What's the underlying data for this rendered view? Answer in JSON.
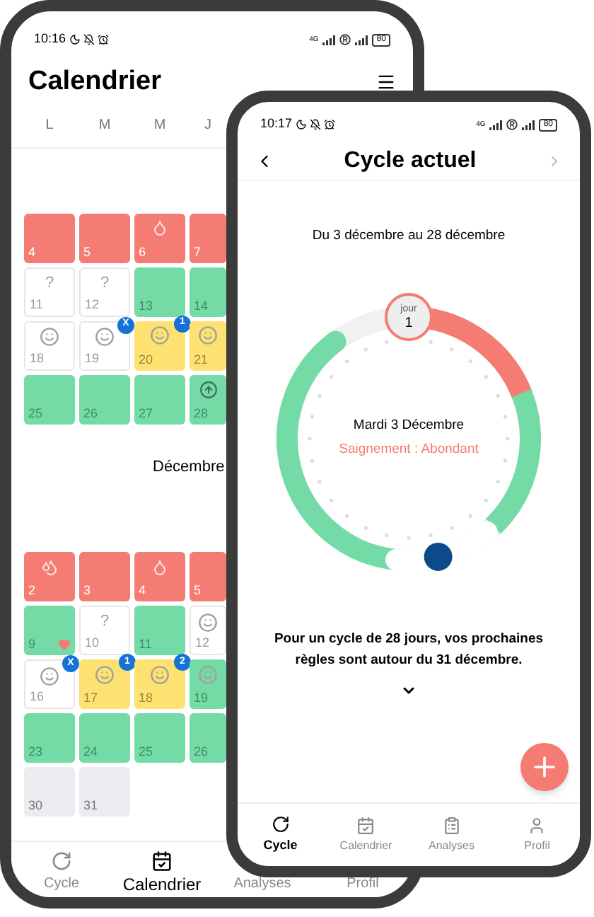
{
  "back_phone": {
    "status_bar": {
      "time": "10:16",
      "network": "4G",
      "battery": "80"
    },
    "title": "Calendrier",
    "weekdays": [
      "L",
      "M",
      "M",
      "J"
    ],
    "months": [
      {
        "weeks": [
          [
            {
              "day": "4",
              "color": "#f47c72",
              "kind": "plain"
            },
            {
              "day": "5",
              "color": "#f47c72",
              "kind": "plain"
            },
            {
              "day": "6",
              "color": "#f47c72",
              "kind": "drop"
            },
            {
              "day": "7",
              "color": "#f47c72",
              "kind": "plain"
            }
          ],
          [
            {
              "day": "11",
              "color": "#ffffff",
              "kind": "question",
              "symbol": "?"
            },
            {
              "day": "12",
              "color": "#ffffff",
              "kind": "question",
              "symbol": "?"
            },
            {
              "day": "13",
              "color": "#74dba6",
              "kind": "plain"
            },
            {
              "day": "14",
              "color": "#74dba6",
              "kind": "plain"
            }
          ],
          [
            {
              "day": "18",
              "color": "#ffffff",
              "kind": "baby"
            },
            {
              "day": "19",
              "color": "#ffffff",
              "kind": "baby",
              "badge": "X"
            },
            {
              "day": "20",
              "color": "#fde272",
              "kind": "baby",
              "badge": "1"
            },
            {
              "day": "21",
              "color": "#fde272",
              "kind": "baby"
            }
          ],
          [
            {
              "day": "25",
              "color": "#74dba6",
              "kind": "plain"
            },
            {
              "day": "26",
              "color": "#74dba6",
              "kind": "plain"
            },
            {
              "day": "27",
              "color": "#74dba6",
              "kind": "plain"
            },
            {
              "day": "28",
              "color": "#74dba6",
              "kind": "arrow"
            }
          ]
        ]
      },
      {
        "label": "Décembre",
        "weeks": [
          [
            {
              "day": "2",
              "color": "#f47c72",
              "kind": "drops"
            },
            {
              "day": "3",
              "color": "#f47c72",
              "kind": "plain"
            },
            {
              "day": "4",
              "color": "#f47c72",
              "kind": "drop"
            },
            {
              "day": "5",
              "color": "#f47c72",
              "kind": "plain"
            }
          ],
          [
            {
              "day": "9",
              "color": "#74dba6",
              "kind": "heart"
            },
            {
              "day": "10",
              "color": "#ffffff",
              "kind": "question",
              "symbol": "?"
            },
            {
              "day": "11",
              "color": "#74dba6",
              "kind": "plain"
            },
            {
              "day": "12",
              "color": "#ffffff",
              "kind": "baby"
            }
          ],
          [
            {
              "day": "16",
              "color": "#ffffff",
              "kind": "baby",
              "badge": "X"
            },
            {
              "day": "17",
              "color": "#fde272",
              "kind": "baby",
              "badge": "1"
            },
            {
              "day": "18",
              "color": "#fde272",
              "kind": "baby",
              "badge": "2"
            },
            {
              "day": "19",
              "color": "#74dba6",
              "kind": "baby"
            }
          ],
          [
            {
              "day": "23",
              "color": "#74dba6",
              "kind": "plain"
            },
            {
              "day": "24",
              "color": "#74dba6",
              "kind": "plain"
            },
            {
              "day": "25",
              "color": "#74dba6",
              "kind": "plain"
            },
            {
              "day": "26",
              "color": "#74dba6",
              "kind": "plain"
            }
          ],
          [
            {
              "day": "30",
              "color": "#ececf0",
              "kind": "plain"
            },
            {
              "day": "31",
              "color": "#ececf0",
              "kind": "plain"
            }
          ]
        ]
      }
    ],
    "nav": [
      {
        "label": "Cycle",
        "selected": false
      },
      {
        "label": "Calendrier",
        "selected": true
      },
      {
        "label": "Analyses",
        "selected": false
      },
      {
        "label": "Profil",
        "selected": false
      }
    ]
  },
  "front_phone": {
    "status_bar": {
      "time": "10:17",
      "network": "4G",
      "battery": "80"
    },
    "title": "Cycle actuel",
    "range": "Du 3 décembre au 28 décembre",
    "day_badge": {
      "label": "jour",
      "value": "1"
    },
    "date": "Mardi 3 Décembre",
    "bleeding": "Saignement : Abondant",
    "prediction": "Pour un cycle de 28 jours, vos prochaines règles sont autour du 31 décembre.",
    "nav": [
      {
        "label": "Cycle",
        "selected": true
      },
      {
        "label": "Calendrier",
        "selected": false
      },
      {
        "label": "Analyses",
        "selected": false
      },
      {
        "label": "Profil",
        "selected": false
      }
    ]
  }
}
